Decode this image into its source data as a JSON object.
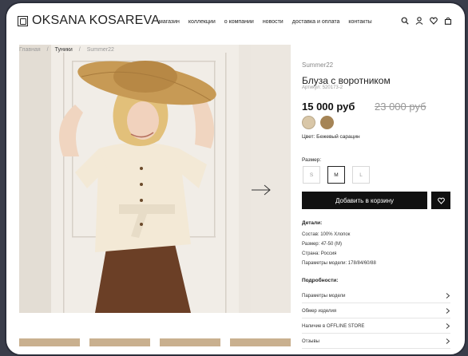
{
  "header": {
    "logo_text": "OKSANA KOSAREVA",
    "nav": [
      "магазин",
      "коллекции",
      "о компании",
      "новости",
      "доставка и оплата",
      "контакты"
    ]
  },
  "breadcrumbs": [
    "Главная",
    "/",
    "Туники",
    "/",
    "Summer22"
  ],
  "product": {
    "collection": "Summer22",
    "title": "Блуза с  воротником",
    "article": "Артикул: 520173-2",
    "price": "15 000 руб",
    "old_price": "23 000 руб",
    "color_label": "Цвет: Бежевый сарацин",
    "colors": [
      "#d9c7a8",
      "#a58456"
    ],
    "size_label": "Размер:",
    "sizes": [
      "S",
      "M",
      "L"
    ],
    "selected_size": "M",
    "add_to_cart": "Добавить в корзину"
  },
  "details": {
    "title": "Детали:",
    "items": [
      "Состав: 100% Хлопок",
      "Размер: 47-50 (M)",
      "Страна: Россия",
      "Параметры модели: 178/84/60/88"
    ]
  },
  "more": {
    "title": "Подробности:",
    "items": [
      "Параметры модели",
      "Обмер изделия",
      "Наличие в OFFLINE STORE",
      "Отзывы"
    ]
  }
}
